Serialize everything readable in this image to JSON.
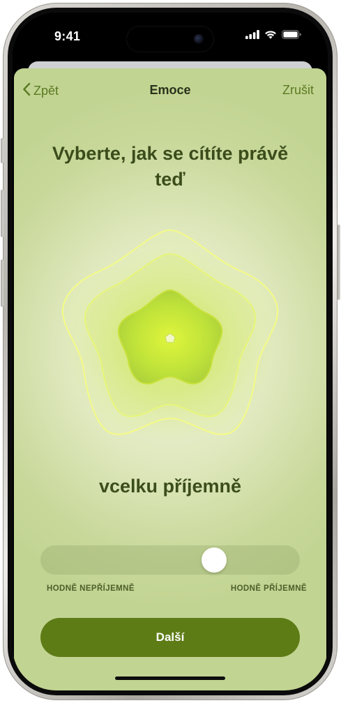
{
  "status_bar": {
    "time": "9:41"
  },
  "nav": {
    "back_label": "Zpět",
    "title": "Emoce",
    "cancel_label": "Zrušit"
  },
  "main": {
    "heading": "Vyberte, jak se cítíte právě teď",
    "mood_label": "vcelku příjemně"
  },
  "slider": {
    "min_label": "HODNĚ NEPŘÍJEMNĚ",
    "max_label": "HODNĚ PŘÍJEMNĚ",
    "value_fraction": 0.69
  },
  "actions": {
    "next_label": "Další"
  },
  "colors": {
    "accent": "#5e7c16",
    "tint_text": "#5a7a22",
    "heading_text": "#3c4d1c",
    "background": "#dfe8bd"
  },
  "icons": {
    "back": "chevron-left-icon",
    "signal": "cellular-signal-icon",
    "wifi": "wifi-icon",
    "battery": "battery-icon",
    "emotion_shape": "flower-shape-icon"
  }
}
